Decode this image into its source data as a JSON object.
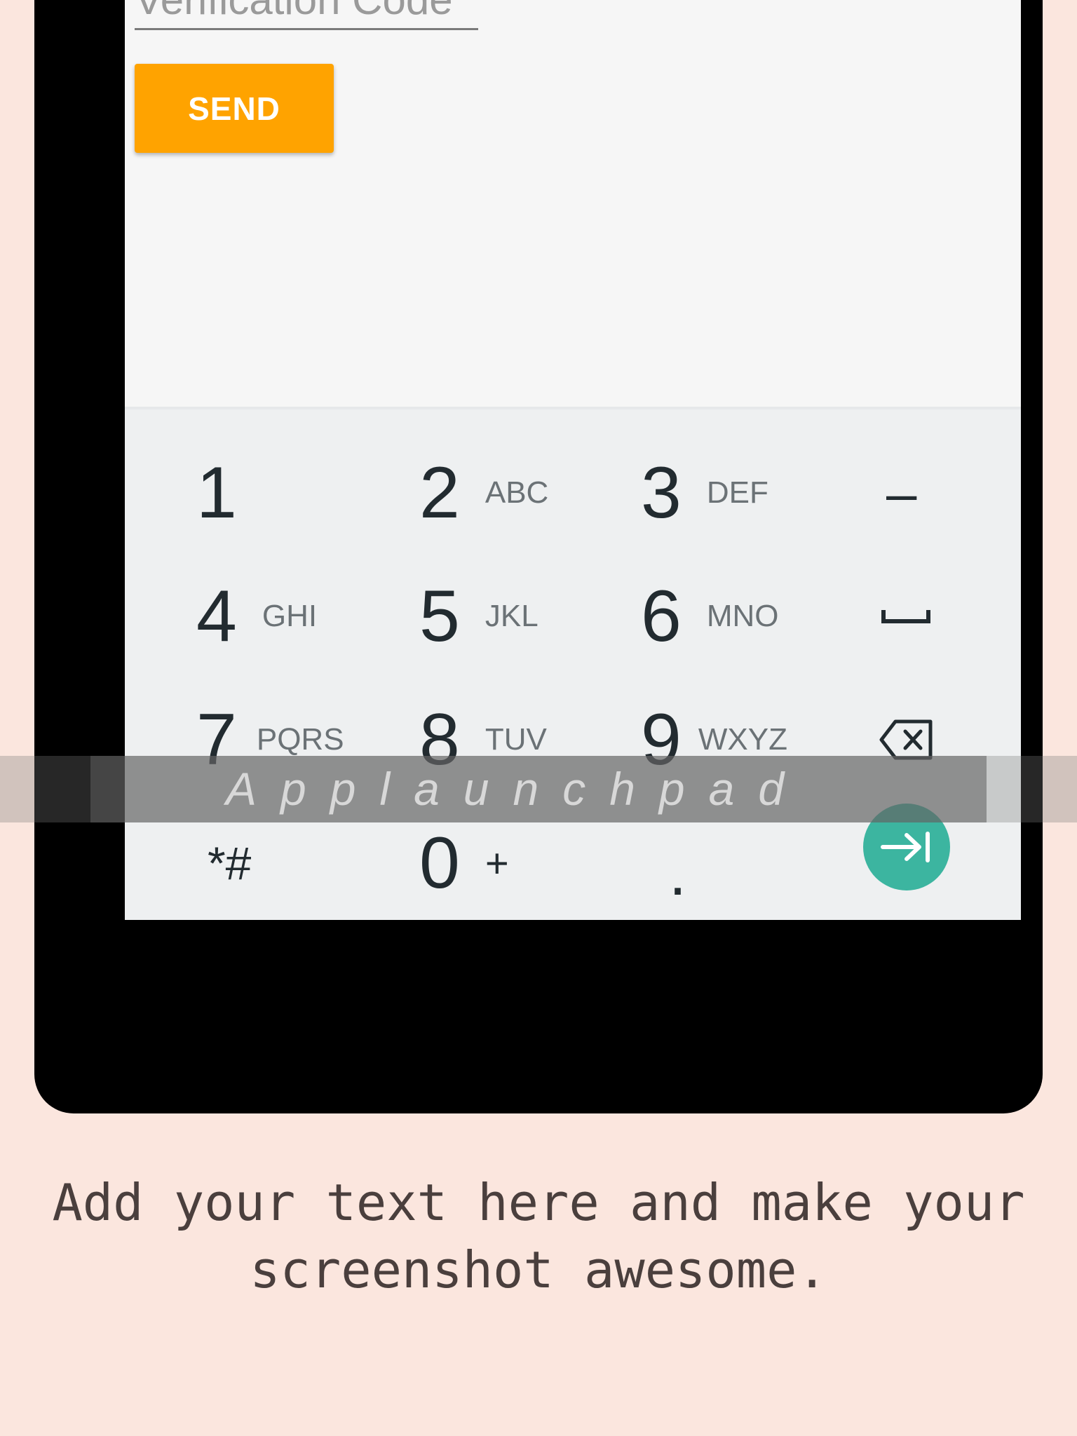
{
  "form": {
    "verification_placeholder": "Verification Code",
    "send_label": "SEND"
  },
  "keypad": {
    "keys": [
      {
        "num": "1",
        "sub": ""
      },
      {
        "num": "2",
        "sub": "ABC"
      },
      {
        "num": "3",
        "sub": "DEF"
      },
      {
        "num": "4",
        "sub": "GHI"
      },
      {
        "num": "5",
        "sub": "JKL"
      },
      {
        "num": "6",
        "sub": "MNO"
      },
      {
        "num": "7",
        "sub": "PQRS"
      },
      {
        "num": "8",
        "sub": "TUV"
      },
      {
        "num": "9",
        "sub": "WXYZ"
      },
      {
        "num": "*#",
        "sub": ""
      },
      {
        "num": "0",
        "sub": "+"
      },
      {
        "num": ".",
        "sub": ""
      }
    ],
    "minus": "–",
    "go_color": "#3cb5a0"
  },
  "watermark": "Applaunchpad",
  "caption": "Add your text here and make your screenshot awesome.",
  "colors": {
    "background": "#fbe6de",
    "send_button": "#ffa300",
    "phone_frame": "#000000"
  }
}
